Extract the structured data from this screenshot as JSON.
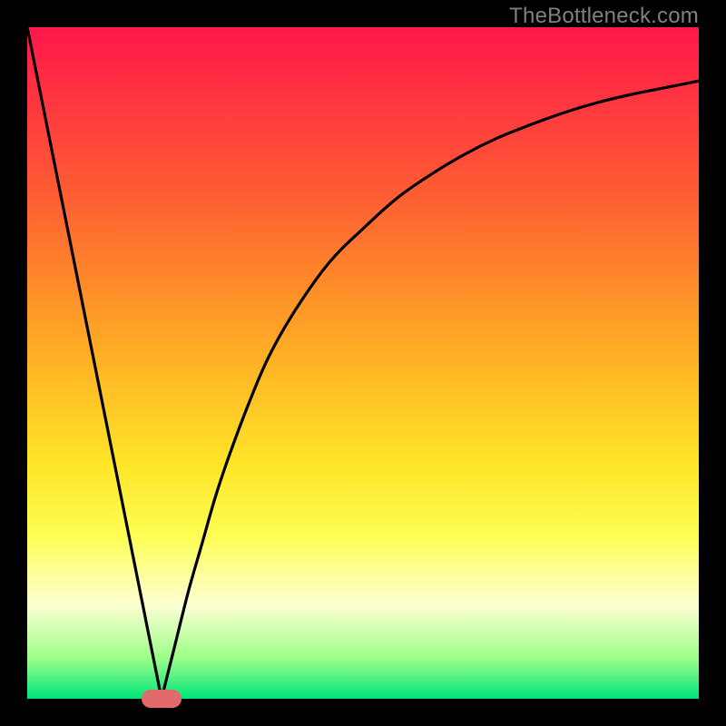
{
  "watermark": "TheBottleneck.com",
  "chart_data": {
    "type": "line",
    "title": "",
    "xlabel": "",
    "ylabel": "",
    "xlim": [
      0,
      100
    ],
    "ylim": [
      0,
      100
    ],
    "grid": false,
    "legend": false,
    "series": [
      {
        "name": "left-branch",
        "x": [
          0,
          20
        ],
        "y": [
          100,
          0
        ]
      },
      {
        "name": "right-branch",
        "x": [
          20,
          22,
          24,
          26,
          28,
          30,
          33,
          36,
          40,
          45,
          50,
          55,
          60,
          65,
          70,
          75,
          80,
          85,
          90,
          95,
          100
        ],
        "y": [
          0,
          8,
          16,
          23,
          30,
          36,
          44,
          51,
          58,
          65,
          70,
          74.5,
          78,
          81,
          83.5,
          85.5,
          87.3,
          88.8,
          90,
          91,
          92
        ]
      }
    ],
    "marker": {
      "x": 20,
      "y": 0,
      "shape": "pill",
      "color": "#e26a6a"
    },
    "background_gradient": {
      "direction": "vertical",
      "stops": [
        {
          "pos": 0.0,
          "color": "#ff174b"
        },
        {
          "pos": 0.25,
          "color": "#ff5d33"
        },
        {
          "pos": 0.5,
          "color": "#ffb324"
        },
        {
          "pos": 0.76,
          "color": "#fdff55"
        },
        {
          "pos": 0.86,
          "color": "#feffd2"
        },
        {
          "pos": 0.94,
          "color": "#9bff89"
        },
        {
          "pos": 1.0,
          "color": "#00e47a"
        }
      ]
    }
  }
}
